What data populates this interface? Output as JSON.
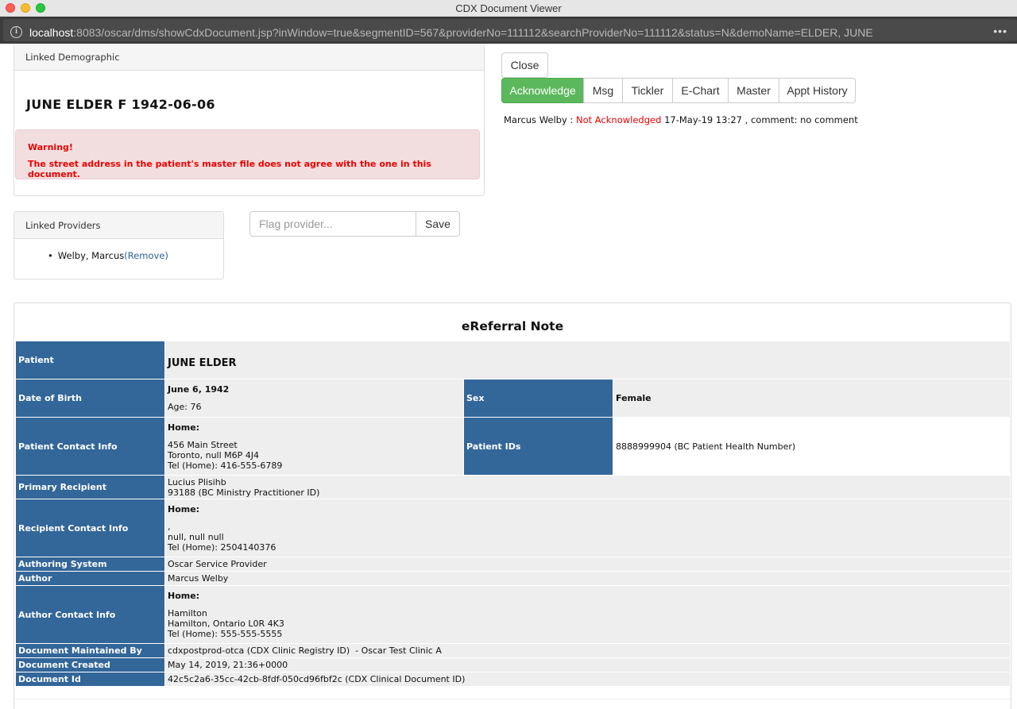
{
  "window": {
    "title": "CDX Document Viewer"
  },
  "url": {
    "host": "localhost",
    "rest": ":8083/oscar/dms/showCdxDocument.jsp?inWindow=true&segmentID=567&providerNo=111112&searchProviderNo=111112&status=N&demoName=ELDER, JUNE"
  },
  "demographic": {
    "heading": "Linked Demographic",
    "name": "JUNE ELDER F 1942-06-06",
    "warning_title": "Warning!",
    "warning_msg": "The street address in the patient's master file does not agree with the one in this document."
  },
  "providers": {
    "heading": "Linked Providers",
    "items": [
      {
        "name": "Welby, Marcus",
        "action": "(Remove)"
      }
    ]
  },
  "flag": {
    "placeholder": "Flag provider...",
    "save_label": "Save"
  },
  "actions": {
    "close": "Close",
    "acknowledge": "Acknowledge",
    "msg": "Msg",
    "tickler": "Tickler",
    "echart": "E-Chart",
    "master": "Master",
    "appt_history": "Appt History",
    "accent_color": "#5cb85c"
  },
  "ack_status": {
    "provider": "Marcus Welby :",
    "status": "Not Acknowledged",
    "rest": "17-May-19 13:27 , comment: no comment"
  },
  "ereferral": {
    "title": "eReferral Note",
    "label_color": "#336699",
    "patient_label": "Patient",
    "patient": "JUNE ELDER",
    "dob_label": "Date of Birth",
    "dob": "June 6, 1942",
    "age": "Age: 76",
    "sex_label": "Sex",
    "sex": "Female",
    "contact_label": "Patient Contact Info",
    "contact_home": "Home:",
    "contact_lines": [
      "456 Main Street",
      "Toronto, null M6P 4J4",
      "Tel (Home): 416-555-6789"
    ],
    "ids_label": "Patient IDs",
    "ids": "8888999904 (BC Patient Health Number)",
    "primary_label": "Primary Recipient",
    "primary_lines": [
      "Lucius Plisihb",
      "93188 (BC Ministry Practitioner ID)"
    ],
    "recip_contact_label": "Recipient Contact Info",
    "recip_home": "Home:",
    "recip_lines": [
      ",",
      "null, null null",
      "Tel (Home): 2504140376"
    ],
    "system_label": "Authoring System",
    "system": "Oscar Service Provider",
    "author_label": "Author",
    "author": "Marcus Welby",
    "author_contact_label": "Author Contact Info",
    "author_home": "Home:",
    "author_lines": [
      "Hamilton",
      "Hamilton, Ontario L0R 4K3",
      "Tel (Home): 555-555-5555"
    ],
    "maintained_label": "Document Maintained By",
    "maintained": "cdxpostprod-otca (CDX Clinic Registry ID)  - Oscar Test Clinic A",
    "created_label": "Document Created",
    "created": "May 14, 2019, 21:36+0000",
    "docid_label": "Document Id",
    "docid": "42c5c2a6-35cc-42cb-8fdf-050cd96fbf2c (CDX Clinical Document ID)"
  }
}
